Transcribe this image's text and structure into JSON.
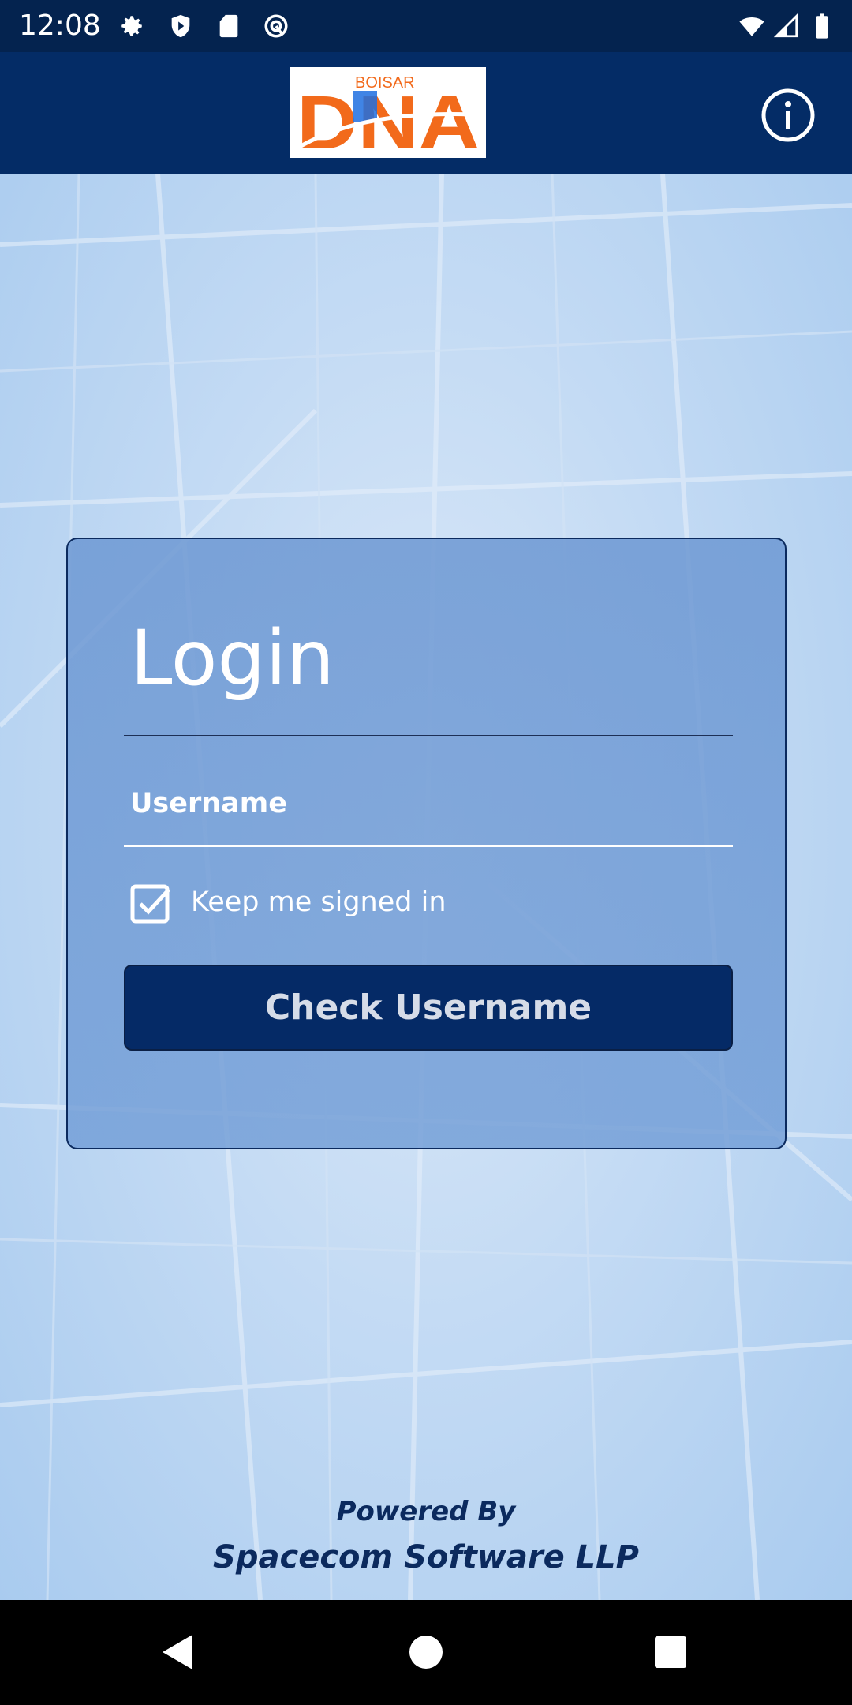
{
  "status_bar": {
    "time": "12:08",
    "icons": [
      "gear-icon",
      "shield-play-icon",
      "sd-card-icon",
      "vpn-icon",
      "wifi-icon",
      "signal-icon",
      "battery-icon"
    ]
  },
  "app_bar": {
    "logo_text": "BOISAR DNA",
    "info_icon": "info-icon"
  },
  "login": {
    "title": "Login",
    "username_label": "Username",
    "keep_signed_in": "Keep me signed in",
    "keep_signed_in_checked": true,
    "button": "Check Username"
  },
  "footer": {
    "powered_by": "Powered By",
    "company": "Spacecom Software LLP"
  },
  "colors": {
    "header": "#042c66",
    "button": "#052a66",
    "logo_orange": "#f26a1b",
    "logo_blue": "#1e6fe0"
  }
}
